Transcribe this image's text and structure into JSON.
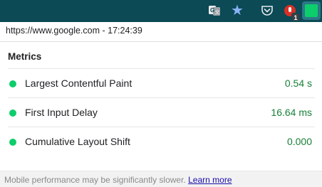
{
  "toolbar": {
    "icons": [
      "translate-icon",
      "star-icon",
      "pocket-icon",
      "extension-icon",
      "web-vitals-extension-icon"
    ],
    "badge": "1",
    "colors": {
      "background": "#0c4a55",
      "star": "#8ab4f8",
      "active_ext": "#0cce6b"
    }
  },
  "popup": {
    "url_line": "https://www.google.com - 17:24:39",
    "section_title": "Metrics",
    "metrics": [
      {
        "label": "Largest Contentful Paint",
        "value": "0.54 s",
        "status": "good"
      },
      {
        "label": "First Input Delay",
        "value": "16.64 ms",
        "status": "good"
      },
      {
        "label": "Cumulative Layout Shift",
        "value": "0.000",
        "status": "good"
      }
    ],
    "footer": {
      "text": "Mobile performance may be significantly slower.",
      "link": "Learn more"
    },
    "colors": {
      "good": "#0cce6b",
      "value_text": "#188038",
      "link": "#1a0dab"
    }
  }
}
